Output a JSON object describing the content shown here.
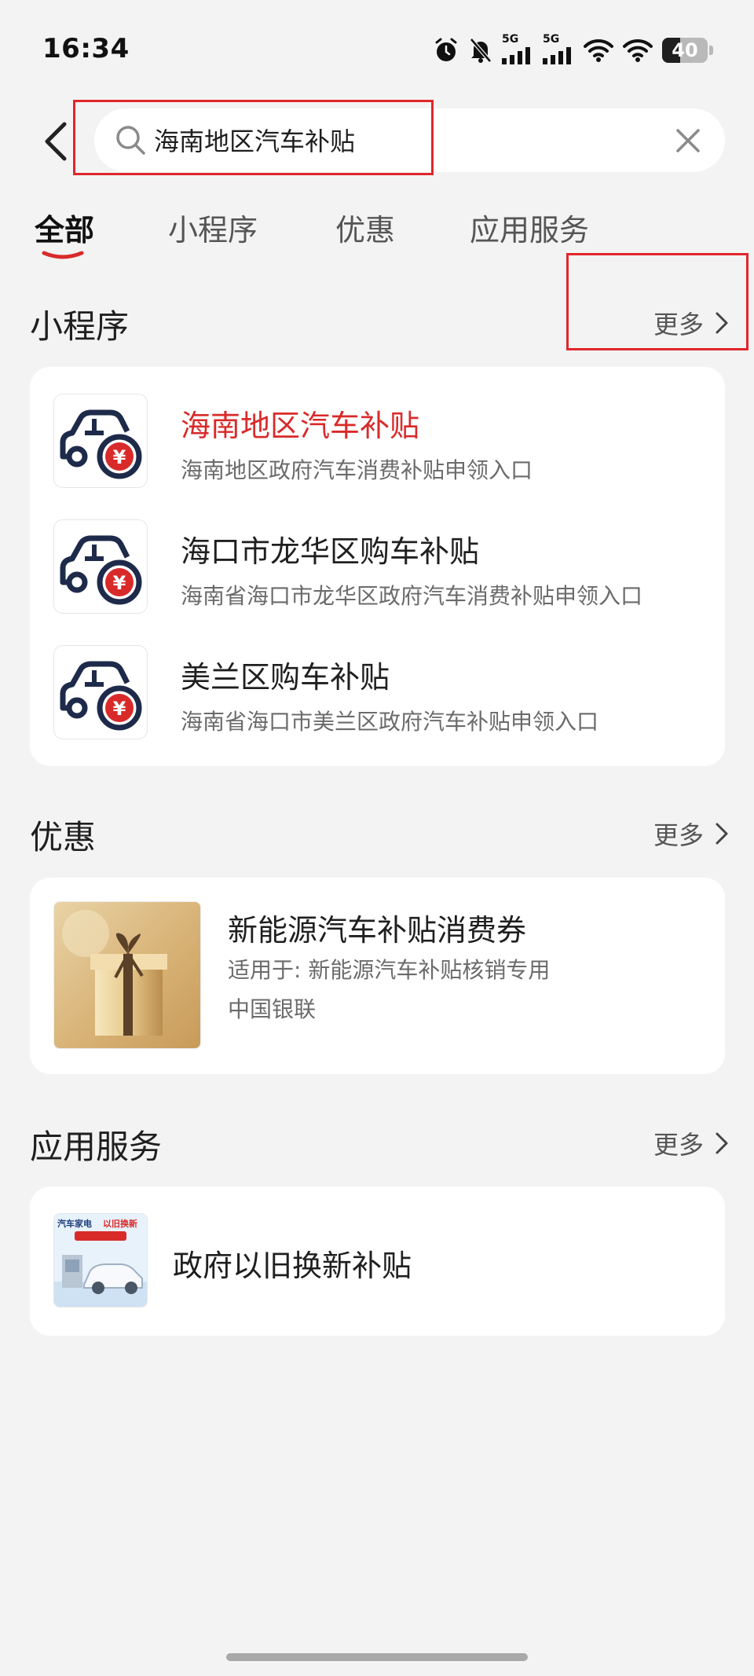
{
  "status_bar": {
    "time": "16:34",
    "net1": "5G",
    "net2": "5G",
    "battery": "40",
    "icons": [
      "alarm-icon",
      "bell-off-icon",
      "signal-icon",
      "signal-icon",
      "wifi-icon",
      "wifi-icon",
      "battery-icon"
    ]
  },
  "search": {
    "query": "海南地区汽车补贴",
    "placeholder": ""
  },
  "tabs": [
    "全部",
    "小程序",
    "优惠",
    "应用服务"
  ],
  "sections": {
    "mini_programs": {
      "title": "小程序",
      "more": "更多",
      "items": [
        {
          "title": "海南地区汽车补贴",
          "desc": "海南地区政府汽车消费补贴申领入口"
        },
        {
          "title": "海口市龙华区购车补贴",
          "desc": "海南省海口市龙华区政府汽车消费补贴申领入口"
        },
        {
          "title": "美兰区购车补贴",
          "desc": "海南省海口市美兰区政府汽车补贴申领入口"
        }
      ]
    },
    "deals": {
      "title": "优惠",
      "more": "更多",
      "item": {
        "title": "新能源汽车补贴消费券",
        "scope": "适用于: 新能源汽车补贴核销专用",
        "issuer": "中国银联"
      }
    },
    "services": {
      "title": "应用服务",
      "more": "更多",
      "item": {
        "title": "政府以旧换新补贴",
        "thumb_text_1": "汽车家电",
        "thumb_text_2": "以旧换新"
      }
    }
  },
  "colors": {
    "accent": "#d92a2a",
    "background": "#f3f3f3",
    "card": "#ffffff",
    "annotation": "#e0262c"
  }
}
